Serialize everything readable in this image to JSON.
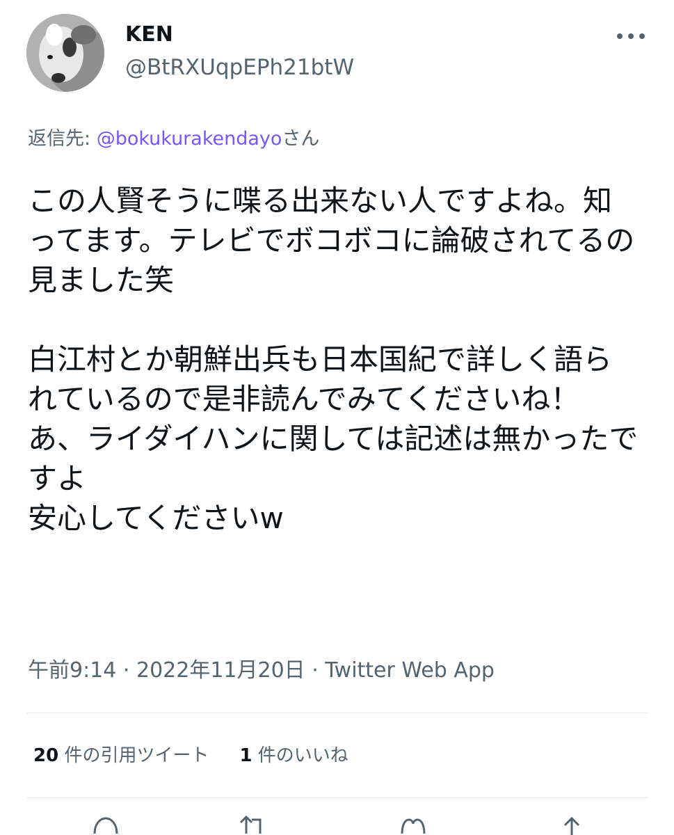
{
  "tweet": {
    "author": {
      "name": "KEN",
      "handle": "@BtRXUqpEPh21btW",
      "avatar": "avatar-dog-photo"
    },
    "reply_to": {
      "prefix": "返信先: ",
      "handle": "@bokukurakendayo",
      "suffix": "さん"
    },
    "text": "この人賢そうに喋る出来ない人ですよね。知ってます。テレビでボコボコに論破されてるの見ました笑\n\n白江村とか朝鮮出兵も日本国紀で詳しく語られているので是非読んでみてくださいね！\nあ、ライダイハンに関しては記述は無かったですよ\n安心してくださいw",
    "time": "午前9:14",
    "separator": " · ",
    "date": "2022年11月20日",
    "source": "Twitter Web App"
  },
  "stats": {
    "quotes_count": "20",
    "quotes_label": " 件の引用ツイート",
    "likes_count": "1",
    "likes_label": " 件のいいね"
  },
  "actions": {
    "icons": [
      "reply-icon",
      "retweet-icon",
      "like-icon",
      "share-icon"
    ]
  },
  "colors": {
    "text": "#0f1419",
    "secondary": "#536471",
    "link": "#7856ff",
    "divider": "#e6e9ec"
  }
}
